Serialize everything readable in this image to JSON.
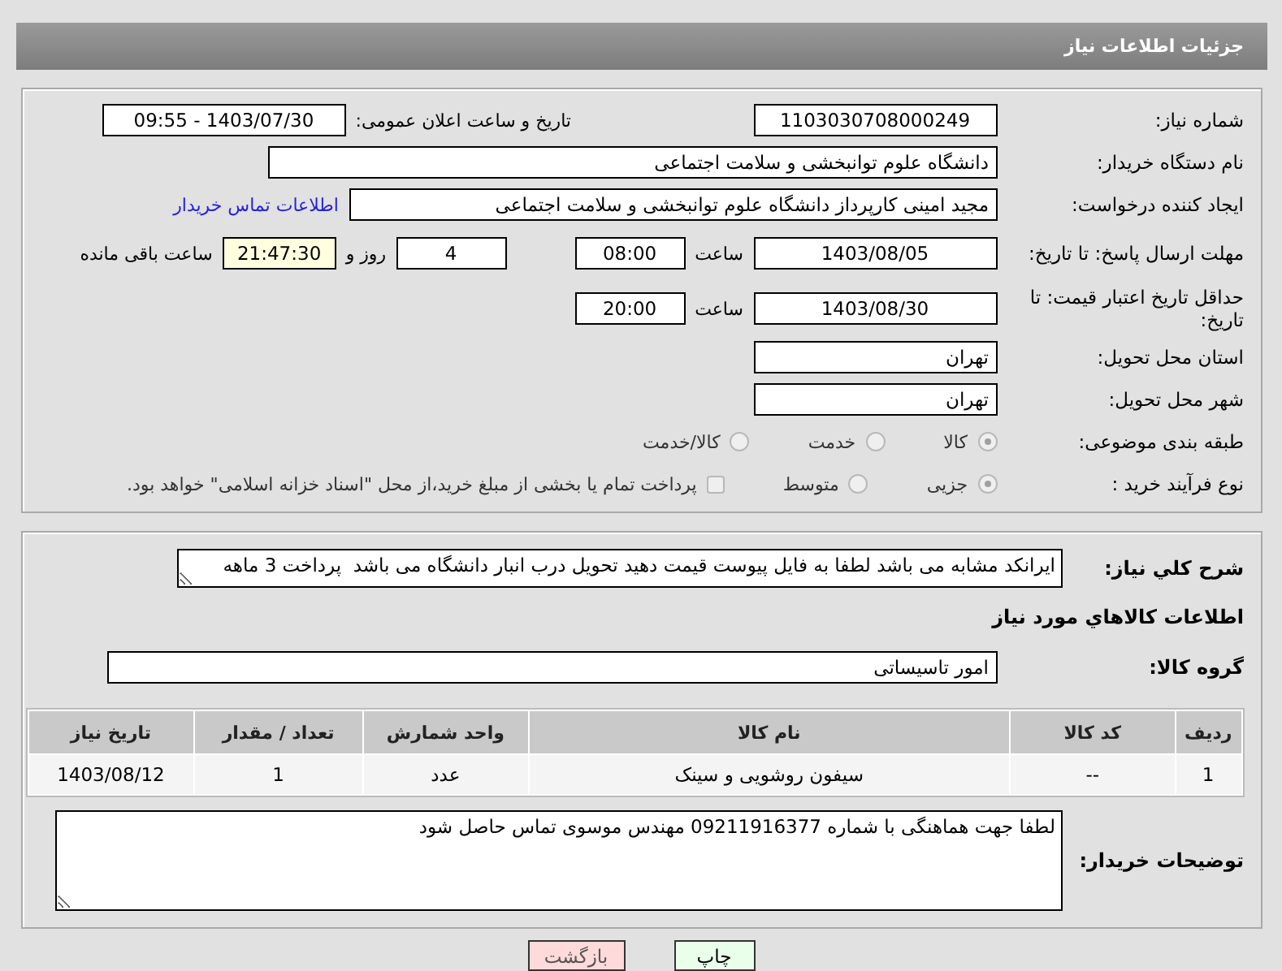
{
  "header": {
    "title": "جزئیات اطلاعات نیاز"
  },
  "details": {
    "need_number": {
      "label": "شماره نیاز:",
      "value": "1103030708000249"
    },
    "announce": {
      "label": "تاریخ و ساعت اعلان عمومی:",
      "value": "1403/07/30 - 09:55"
    },
    "buyer_org": {
      "label": "نام دستگاه خریدار:",
      "value": "دانشگاه علوم توانبخشی و سلامت اجتماعی"
    },
    "requester": {
      "label": "ایجاد کننده درخواست:",
      "value": "مجید امینی کارپرداز دانشگاه علوم توانبخشی و سلامت اجتماعی",
      "link": "اطلاعات تماس خریدار"
    },
    "reply_deadline": {
      "label": "مهلت ارسال پاسخ: تا تاریخ:",
      "date": "1403/08/05",
      "time_label": "ساعت",
      "time": "08:00",
      "days": "4",
      "days_label": "روز و",
      "remaining": "21:47:30",
      "remaining_label": "ساعت باقی مانده"
    },
    "price_validity": {
      "label": "حداقل تاریخ اعتبار قیمت: تا تاریخ:",
      "date": "1403/08/30",
      "time_label": "ساعت",
      "time": "20:00"
    },
    "province": {
      "label": "استان محل تحویل:",
      "value": "تهران"
    },
    "city": {
      "label": "شهر محل تحویل:",
      "value": "تهران"
    },
    "category": {
      "label": "طبقه بندی موضوعی:",
      "options": [
        {
          "label": "کالا",
          "selected": true
        },
        {
          "label": "خدمت",
          "selected": false
        },
        {
          "label": "کالا/خدمت",
          "selected": false
        }
      ]
    },
    "process": {
      "label": "نوع فرآیند خرید :",
      "options": [
        {
          "label": "جزیی",
          "selected": true
        },
        {
          "label": "متوسط",
          "selected": false
        }
      ],
      "payment_note": {
        "checked": false,
        "text": "پرداخت تمام یا بخشی از مبلغ خرید،از محل \"اسناد خزانه اسلامی\" خواهد بود."
      }
    }
  },
  "goods": {
    "description": {
      "label": "شرح کلي نياز:",
      "value": "ایرانکد مشابه می باشد لطفا به فایل پیوست قیمت دهید تحویل درب انبار دانشگاه می باشد  پرداخت 3 ماهه"
    },
    "section_title": "اطلاعات کالاهاي مورد نياز",
    "group": {
      "label": "گروه کالا:",
      "value": "امور تاسیساتی"
    },
    "table": {
      "columns": [
        "ردیف",
        "کد کالا",
        "نام کالا",
        "واحد شمارش",
        "تعداد / مقدار",
        "تاریخ نیاز"
      ],
      "rows": [
        [
          "1",
          "--",
          "سیفون روشویی و سینک",
          "عدد",
          "1",
          "1403/08/12"
        ]
      ]
    },
    "buyer_notes": {
      "label": "توضیحات خریدار:",
      "value": "لطفا جهت هماهنگی با شماره 09211916377 مهندس موسوی تماس حاصل شود"
    }
  },
  "buttons": [
    {
      "label": "چاپ",
      "kind": "print"
    },
    {
      "label": "بازگشت",
      "kind": "back"
    }
  ]
}
